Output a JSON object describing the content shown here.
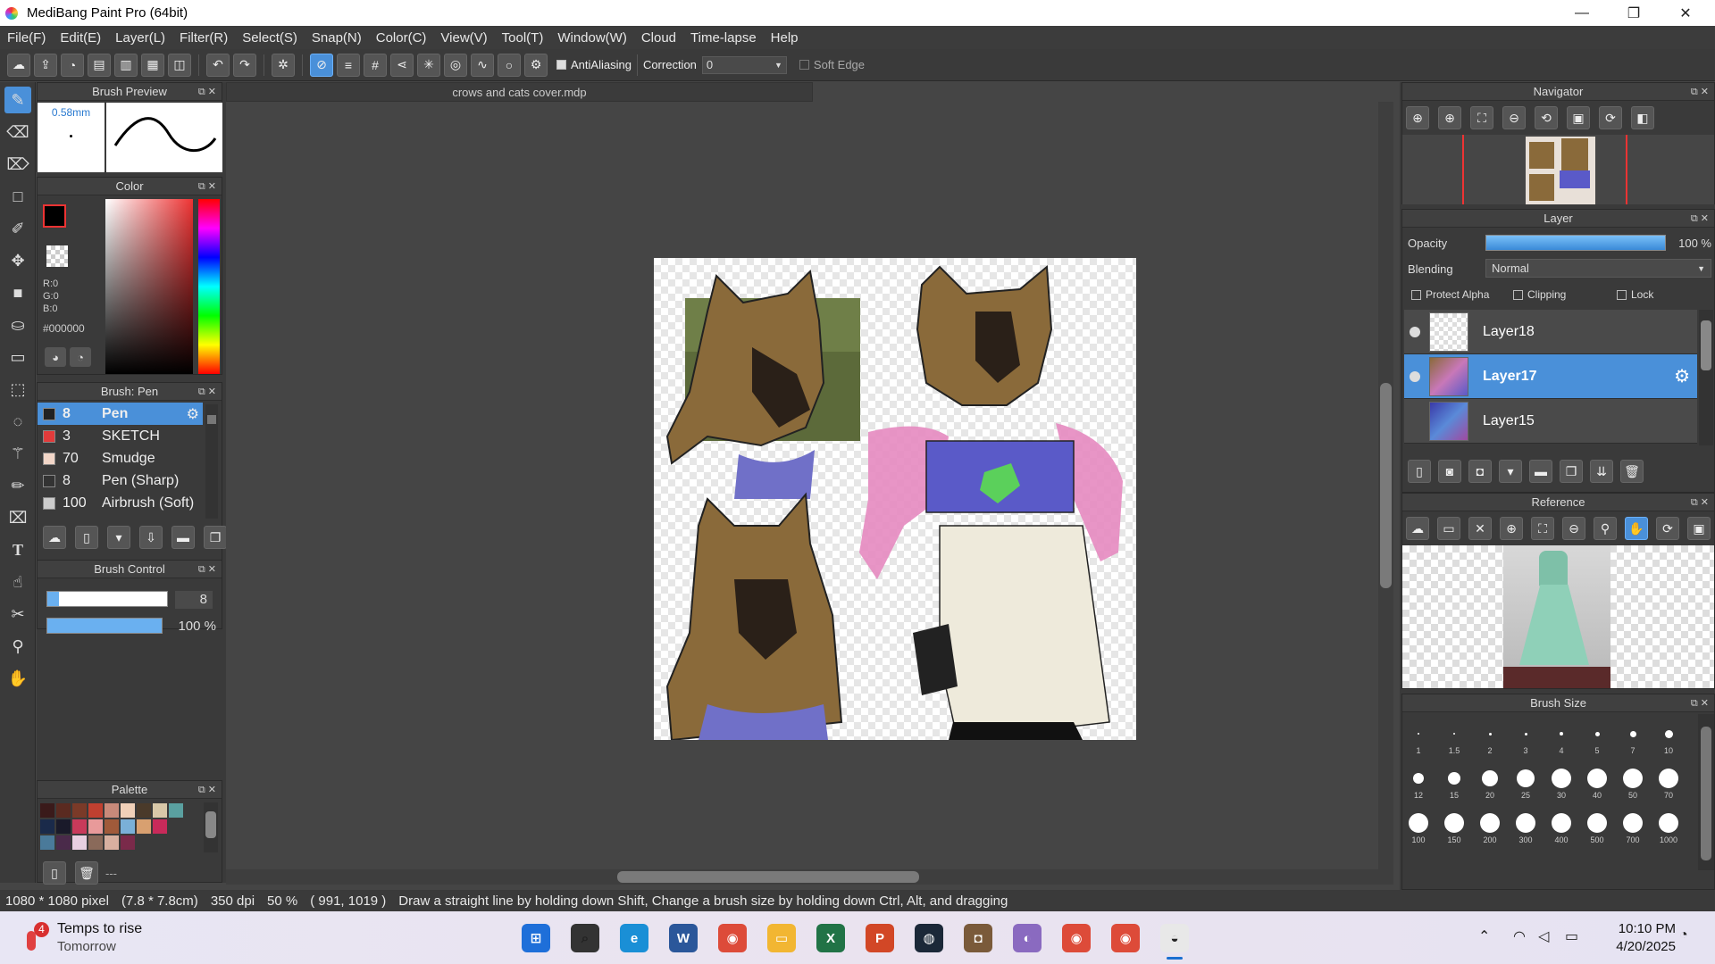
{
  "window": {
    "title": "MediBang Paint Pro (64bit)",
    "minimize_icon": "—",
    "maximize_icon": "❐",
    "close_icon": "✕"
  },
  "menu": [
    "File(F)",
    "Edit(E)",
    "Layer(L)",
    "Filter(R)",
    "Select(S)",
    "Snap(N)",
    "Color(C)",
    "View(V)",
    "Tool(T)",
    "Window(W)",
    "Cloud",
    "Time-lapse",
    "Help"
  ],
  "toolbar": {
    "antialiasing_label": "AntiAliasing",
    "correction_label": "Correction",
    "correction_value": "0",
    "soft_edge_label": "Soft Edge"
  },
  "brush_preview": {
    "title": "Brush Preview",
    "size_label": "0.58mm"
  },
  "color_panel": {
    "title": "Color",
    "r": "R:0",
    "g": "G:0",
    "b": "B:0",
    "hex": "#000000",
    "foreground": "#000000",
    "background": "#ffffff"
  },
  "brush_list": {
    "title": "Brush: Pen",
    "items": [
      {
        "size": "8",
        "name": "Pen",
        "color": "#222222",
        "selected": true
      },
      {
        "size": "3",
        "name": "SKETCH",
        "color": "#e23b3b"
      },
      {
        "size": "70",
        "name": "Smudge",
        "color": "#f2d6c8"
      },
      {
        "size": "8",
        "name": "Pen (Sharp)",
        "color": "#333333"
      },
      {
        "size": "100",
        "name": "Airbrush (Soft)",
        "color": "#cccccc"
      }
    ]
  },
  "brush_control": {
    "title": "Brush Control",
    "size_value": "8",
    "opacity_value": "100 %",
    "size_fraction": 0.1,
    "opacity_fraction": 1.0
  },
  "palette": {
    "title": "Palette",
    "footer_text": "---",
    "colors": [
      "#3a1a1a",
      "#5a2a20",
      "#7a3a28",
      "#c04030",
      "#c88a7a",
      "#f0d0b8",
      "#4a3a2a",
      "#d8c8a8",
      "#5aa0a0",
      "#1a2a4a",
      "#1a1a2a",
      "#c83a5a",
      "#e89a9a",
      "#a05a3a",
      "#7ab0d8",
      "#d8a070",
      "#c82a5a",
      "#3a3a3a",
      "#4a7a9a",
      "#4a2a4a",
      "#e8d0e0",
      "#8a6a5a",
      "#d8b0a0",
      "#7a2a4a"
    ]
  },
  "document": {
    "tab_title": "crows and cats cover.mdp"
  },
  "navigator": {
    "title": "Navigator"
  },
  "layer_panel": {
    "title": "Layer",
    "opacity_label": "Opacity",
    "opacity_value": "100 %",
    "opacity_fraction": 1.0,
    "blending_label": "Blending",
    "blending_value": "Normal",
    "protect_alpha": "Protect Alpha",
    "clipping": "Clipping",
    "lock": "Lock",
    "layers": [
      {
        "name": "Layer18",
        "selected": false
      },
      {
        "name": "Layer17",
        "selected": true
      },
      {
        "name": "Layer15",
        "selected": false
      }
    ]
  },
  "reference": {
    "title": "Reference"
  },
  "brush_size": {
    "title": "Brush Size",
    "sizes": [
      "1",
      "1.5",
      "2",
      "3",
      "4",
      "5",
      "7",
      "10",
      "12",
      "15",
      "20",
      "25",
      "30",
      "40",
      "50",
      "70",
      "100",
      "150",
      "200",
      "300",
      "400",
      "500",
      "700",
      "1000"
    ]
  },
  "status": {
    "dimensions": "1080 * 1080 pixel",
    "physical": "(7.8 * 7.8cm)",
    "dpi": "350 dpi",
    "zoom": "50 %",
    "cursor": "( 991, 1019 )",
    "hint": "Draw a straight line by holding down Shift, Change a brush size by holding down Ctrl, Alt, and dragging"
  },
  "taskbar": {
    "weather_badge": "4",
    "weather_title": "Temps to rise",
    "weather_sub": "Tomorrow",
    "time": "10:10 PM",
    "date": "4/20/2025",
    "apps": [
      {
        "name": "start",
        "color": "#1e6fd9",
        "glyph": "⊞"
      },
      {
        "name": "search",
        "color": "#333333",
        "glyph": "⌕"
      },
      {
        "name": "edge",
        "color": "#1a8fd6",
        "glyph": "e"
      },
      {
        "name": "word",
        "color": "#2b579a",
        "glyph": "W"
      },
      {
        "name": "chrome",
        "color": "#dd4b39",
        "glyph": "◉"
      },
      {
        "name": "files",
        "color": "#f2b632",
        "glyph": "▭"
      },
      {
        "name": "excel",
        "color": "#217346",
        "glyph": "X"
      },
      {
        "name": "powerpoint",
        "color": "#d24726",
        "glyph": "P"
      },
      {
        "name": "steam",
        "color": "#1b2838",
        "glyph": "◍"
      },
      {
        "name": "app-cat",
        "color": "#7a5a3a",
        "glyph": "◘"
      },
      {
        "name": "app-paint",
        "color": "#8a6ac0",
        "glyph": "◐"
      },
      {
        "name": "chrome-profile-1",
        "color": "#dd4b39",
        "glyph": "◉"
      },
      {
        "name": "chrome-profile-2",
        "color": "#dd4b39",
        "glyph": "◉"
      },
      {
        "name": "medibang",
        "color": "#e8e8e8",
        "glyph": "◒"
      }
    ]
  }
}
